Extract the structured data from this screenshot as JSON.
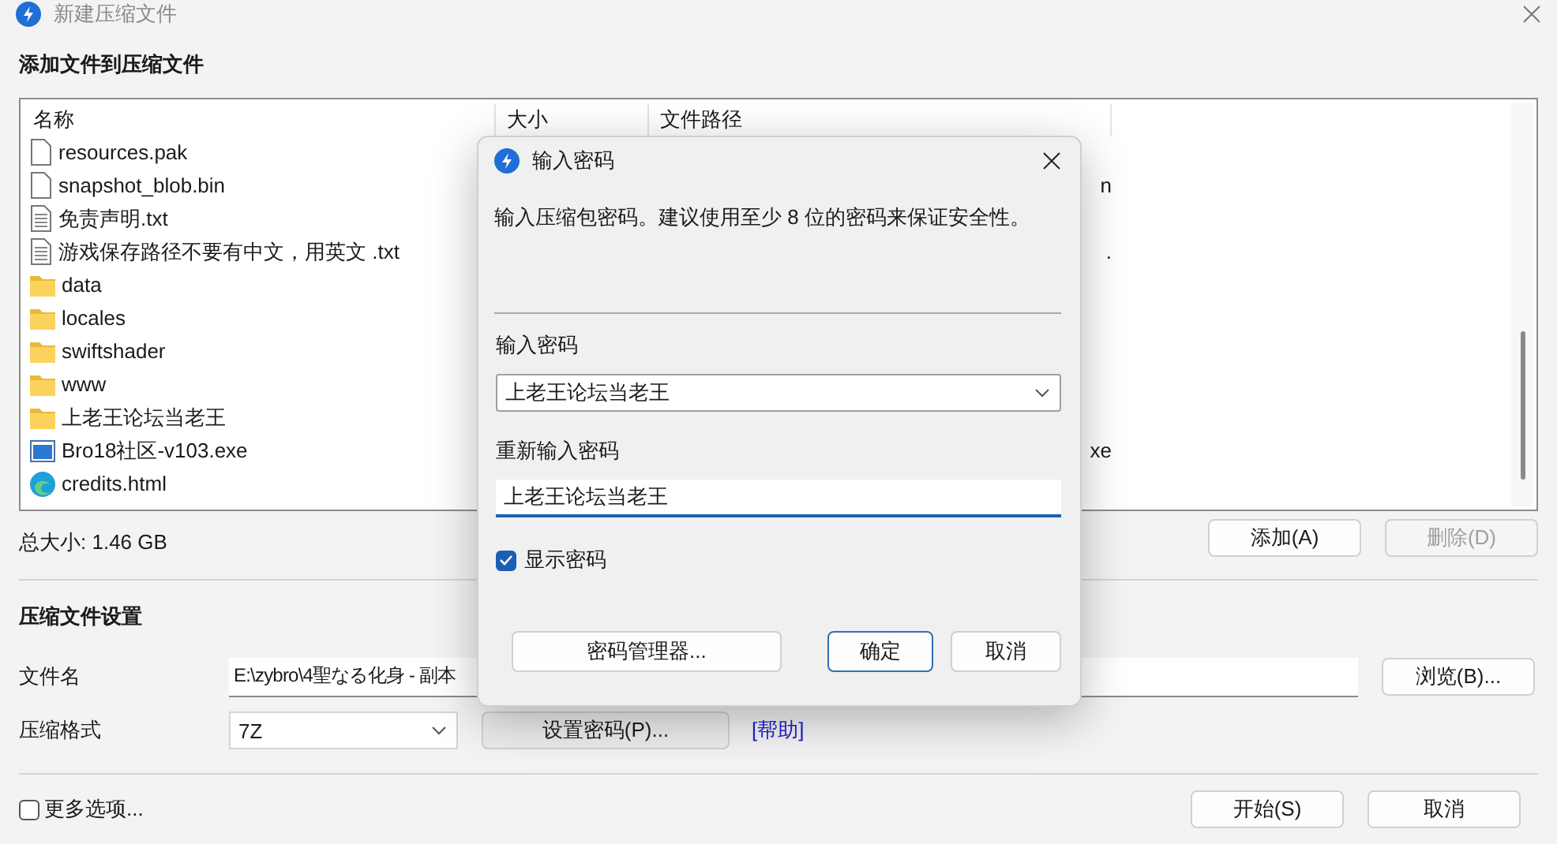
{
  "window": {
    "title": "新建压缩文件"
  },
  "add_section": {
    "heading": "添加文件到压缩文件"
  },
  "file_list": {
    "columns": [
      "名称",
      "大小",
      "文件路径"
    ],
    "rows": [
      {
        "name": "resources.pak",
        "kind": "file"
      },
      {
        "name": "snapshot_blob.bin",
        "kind": "file",
        "path": "n"
      },
      {
        "name": "免责声明.txt",
        "kind": "text"
      },
      {
        "name": "游戏保存路径不要有中文，用英文 .txt",
        "kind": "text",
        "path": "."
      },
      {
        "name": "data",
        "kind": "folder"
      },
      {
        "name": "locales",
        "kind": "folder"
      },
      {
        "name": "swiftshader",
        "kind": "folder"
      },
      {
        "name": "www",
        "kind": "folder"
      },
      {
        "name": "上老王论坛当老王",
        "kind": "folder"
      },
      {
        "name": "Bro18社区-v103.exe",
        "kind": "exe",
        "path": "xe"
      },
      {
        "name": "credits.html",
        "kind": "html"
      }
    ]
  },
  "total_size": "总大小: 1.46 GB",
  "list_buttons": [
    {
      "label": "添加(A)",
      "disabled": false
    },
    {
      "label": "删除(D)",
      "disabled": true
    }
  ],
  "settings": {
    "heading": "压缩文件设置",
    "filename_label": "文件名",
    "filename": "E:\\zybro\\4聖なる化身 - 副本",
    "browse_button": "浏览(B)...",
    "format_label": "压缩格式",
    "format": "7Z",
    "password_button": "设置密码(P)...",
    "help_link": "[帮助]"
  },
  "more_options": {
    "label": "更多选项...",
    "checked": false
  },
  "footer_buttons": [
    "开始(S)",
    "取消"
  ],
  "password_dialog": {
    "title": "输入密码",
    "description": "输入压缩包密码。建议使用至少 8 位的密码来保证安全性。",
    "password_label": "输入密码",
    "password": "上老王论坛当老王",
    "repeat_label": "重新输入密码",
    "repeat": "上老王论坛当老王",
    "show_password": {
      "label": "显示密码",
      "checked": true
    },
    "buttons": [
      {
        "label": "密码管理器...",
        "default": false
      },
      {
        "label": "确定",
        "default": true
      },
      {
        "label": "取消",
        "default": false
      }
    ]
  }
}
